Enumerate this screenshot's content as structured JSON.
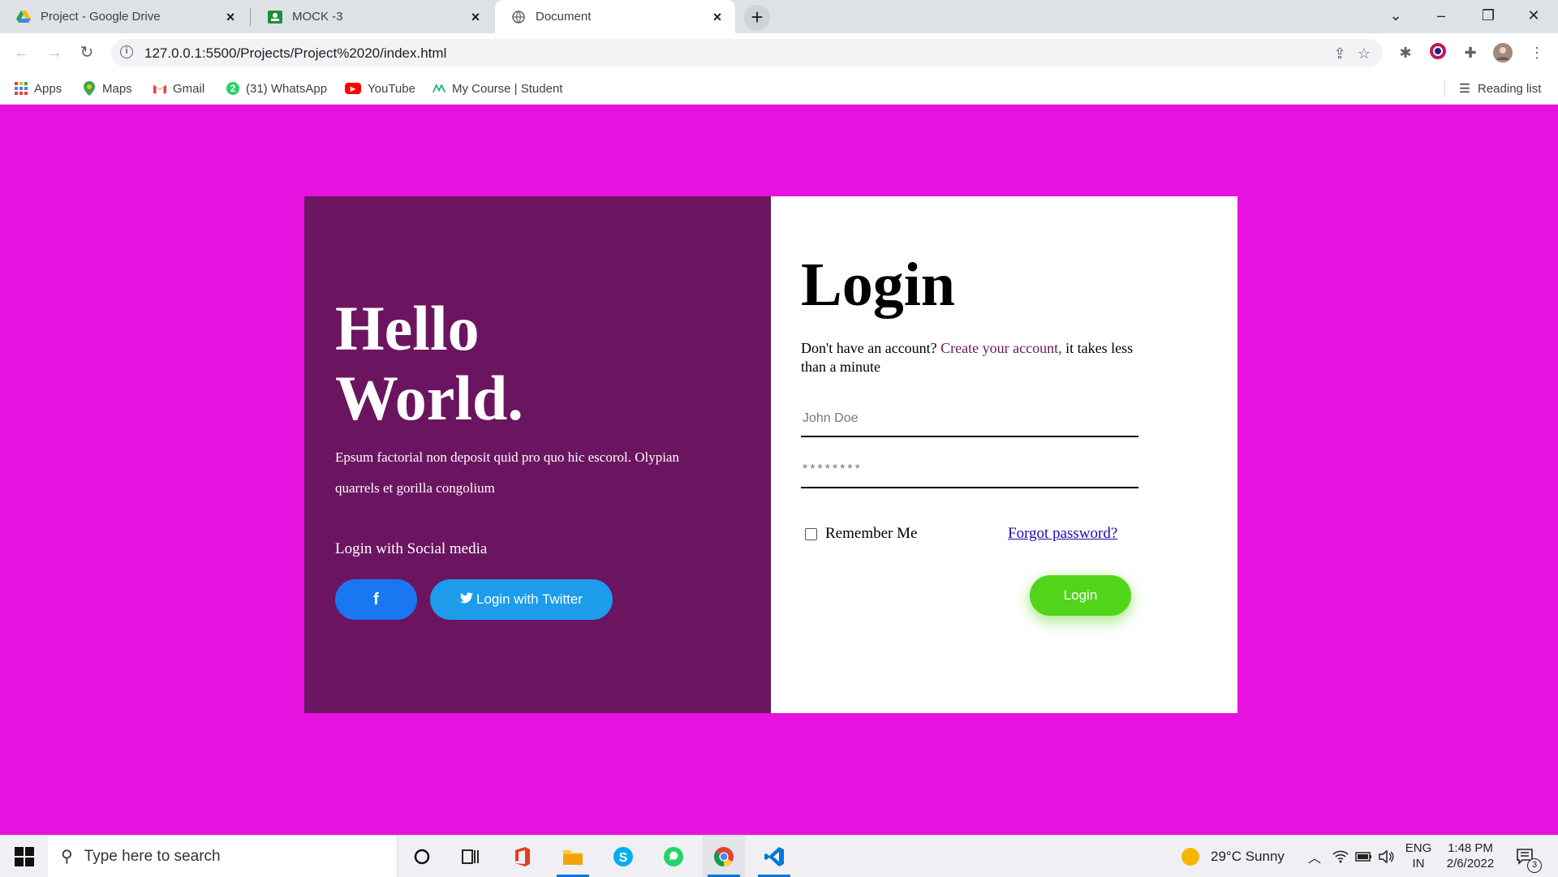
{
  "browser": {
    "tabs": [
      {
        "title": "Project - Google Drive",
        "icon": "google-drive-icon",
        "active": false
      },
      {
        "title": "MOCK -3",
        "icon": "google-classroom-icon",
        "active": false
      },
      {
        "title": "Document",
        "icon": "globe-icon",
        "active": true
      }
    ],
    "url": "127.0.0.1:5500/Projects/Project%2020/index.html",
    "bookmarks": [
      "Apps",
      "Maps",
      "Gmail",
      "(31) WhatsApp",
      "YouTube",
      "My Course | Student"
    ],
    "reading_list": "Reading list"
  },
  "page": {
    "background": "#e812e0",
    "left_panel": {
      "heading_line1": "Hello",
      "heading_line2": "World.",
      "description": "Epsum factorial non deposit quid pro quo hic escorol. Olypian quarrels et gorilla congolium",
      "social_title": "Login with Social media",
      "facebook_label": "f",
      "twitter_label": "Login with Twitter",
      "colors": {
        "panel": "#6b1561",
        "facebook": "#1977f2",
        "twitter": "#1c9ceb"
      }
    },
    "right_panel": {
      "title": "Login",
      "signup_prefix": "Don't have an account?",
      "signup_link": "Create your account,",
      "signup_suffix": "it takes less than a minute",
      "username_placeholder": "John Doe",
      "password_placeholder": "********",
      "remember_label": "Remember Me",
      "forgot_label": "Forgot password?",
      "login_label": "Login",
      "colors": {
        "button": "#52d41a"
      }
    }
  },
  "taskbar": {
    "search_placeholder": "Type here to search",
    "weather": "29°C  Sunny",
    "language_line1": "ENG",
    "language_line2": "IN",
    "time": "1:48 PM",
    "date": "2/6/2022",
    "notification_count": "3"
  }
}
